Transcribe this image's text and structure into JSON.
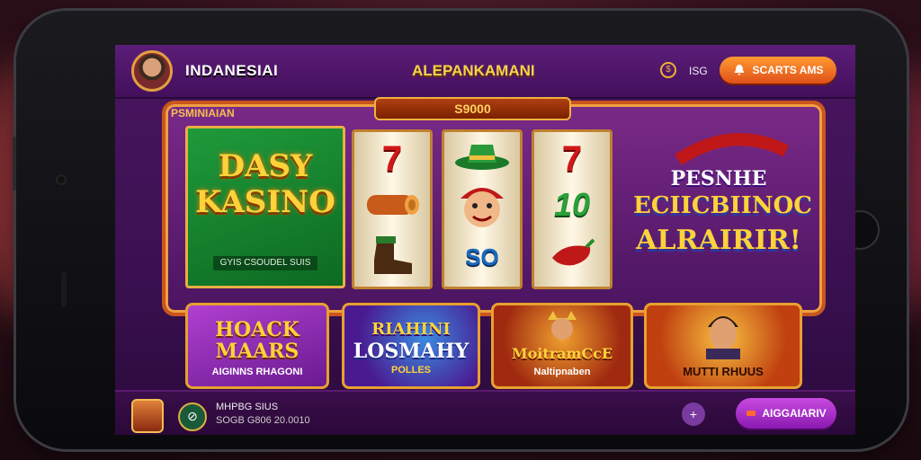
{
  "header": {
    "app_title": "INDANESIAI",
    "center_title": "ALEPANKAMANI",
    "coin_symbol": "$",
    "coin_text": "ISG",
    "start_label": "SCARTS AMS",
    "start_icon": "bell-icon"
  },
  "machine": {
    "label": "PSMINIAIAN",
    "jackpot": "S9000",
    "green_panel": {
      "line1": "DASY",
      "line2": "KASINO",
      "sub": "GYIS CSOUDEL SUIS"
    },
    "reels": [
      [
        "7",
        "log",
        "boot"
      ],
      [
        "hat",
        "face",
        "SO"
      ],
      [
        "7",
        "10",
        "pepper"
      ]
    ],
    "promo": {
      "line1": "PESNHE",
      "line2": "ECIICBIINOC",
      "line3": "ALRAIRIR!"
    }
  },
  "games": [
    {
      "title1": "HOACK",
      "title2": "MAARS",
      "sub": "AIGINNS RHAGONI"
    },
    {
      "title1": "RIAHINI",
      "title2": "LOSMAHY",
      "sub": "POLLES"
    },
    {
      "title1": "MoitramCcE",
      "title2": "",
      "sub": "Naltipnaben"
    },
    {
      "title1": "",
      "title2": "",
      "sub": "MUTTI RHUUS"
    }
  ],
  "footer": {
    "line1": "MHPBG SIUS",
    "line2": "SOGB G806 20.0010",
    "plus_icon": "plus-icon",
    "play_label": "AIGGAIARIV",
    "play_icon": "ticket-icon"
  },
  "colors": {
    "accent": "#f0a030",
    "purple": "#4a1660",
    "green": "#1f9a3a"
  }
}
